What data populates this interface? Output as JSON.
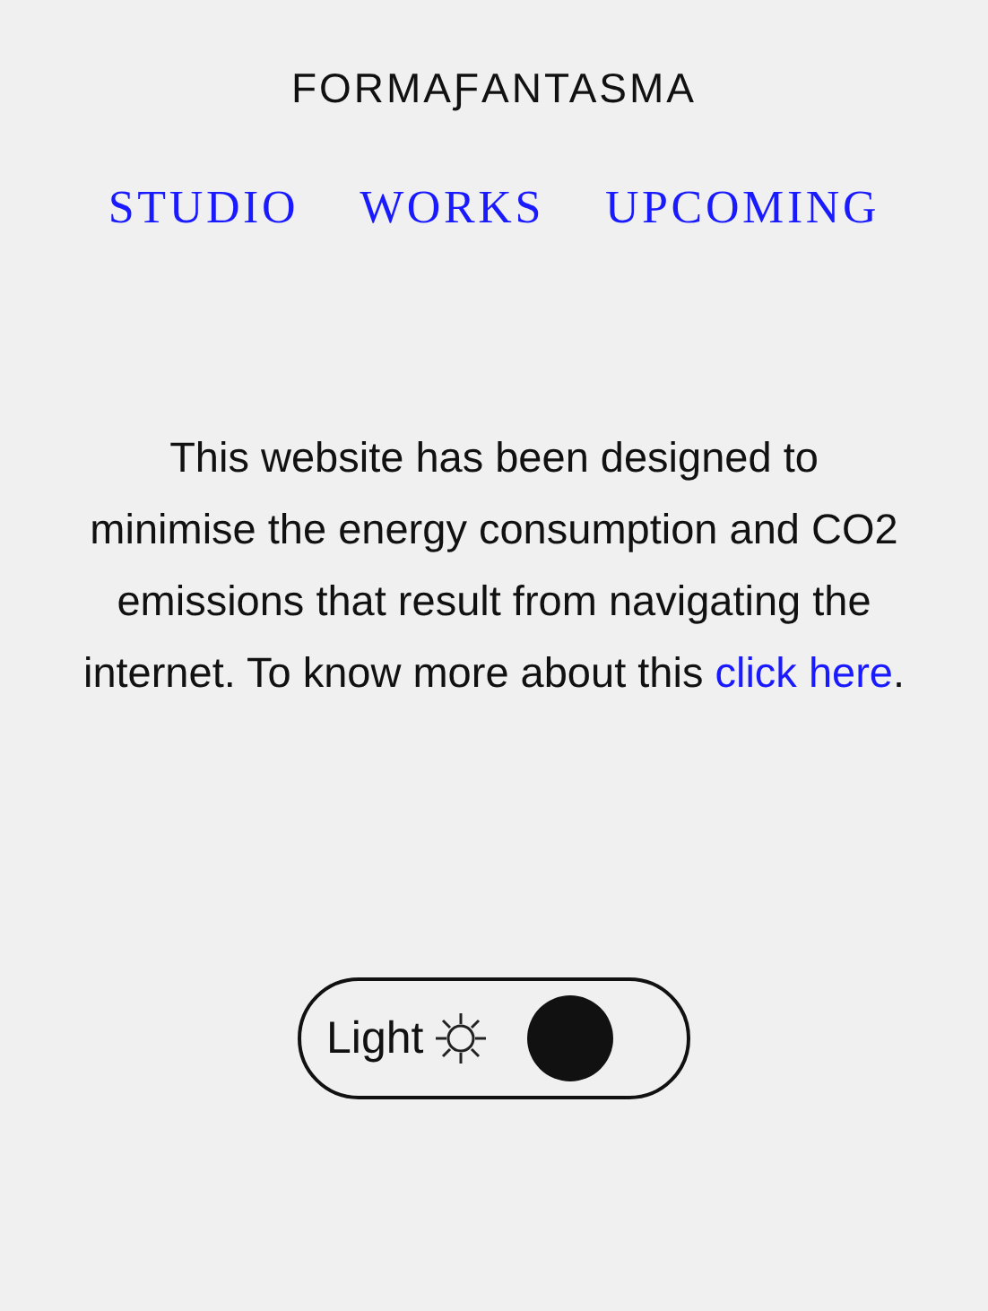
{
  "logo": "FORMAƑANTASMA",
  "nav": [
    {
      "label": "STUDIO"
    },
    {
      "label": "WORKS"
    },
    {
      "label": "UPCOMING"
    }
  ],
  "notice": {
    "text": "This website has been designed to minimise the energy consumption and CO2 emissions that result from navigating the internet. To know more about this ",
    "link": "click here",
    "end": "."
  },
  "theme_toggle": {
    "label": "Light",
    "on": false
  }
}
